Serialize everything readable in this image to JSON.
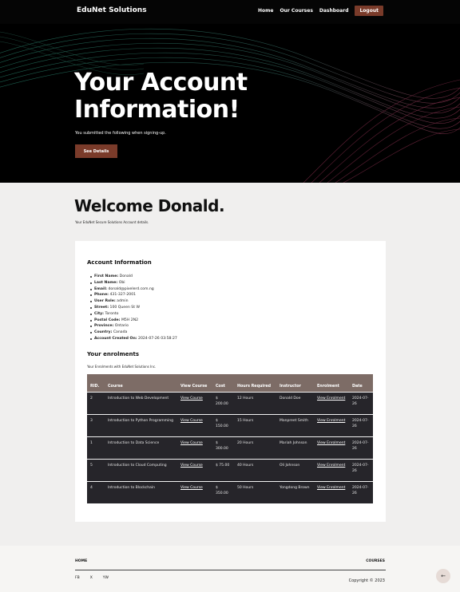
{
  "nav": {
    "brand": "EduNet Solutions",
    "links": [
      "Home",
      "Our Courses",
      "Dashboard"
    ],
    "logout": "Logout"
  },
  "hero": {
    "title_line1": "Your Account",
    "title_line2": "Information!",
    "subtitle": "You submitted the following when signing-up.",
    "button": "See Details"
  },
  "welcome": {
    "title": "Welcome Donald.",
    "subtitle": "Your EduNet Secure Solutions Account details."
  },
  "account": {
    "heading": "Account Information",
    "fields": [
      {
        "label": "First Name:",
        "value": "Donald"
      },
      {
        "label": "Last Name:",
        "value": "Obi"
      },
      {
        "label": "Email:",
        "value": "donald@pixelerd.com.ng"
      },
      {
        "label": "Phone:",
        "value": "431-327-2001"
      },
      {
        "label": "User Role:",
        "value": "admin"
      },
      {
        "label": "Street:",
        "value": "100 Queen St W"
      },
      {
        "label": "City:",
        "value": "Toronto"
      },
      {
        "label": "Postal Code:",
        "value": "M5H 2N2"
      },
      {
        "label": "Province:",
        "value": "Ontario"
      },
      {
        "label": "Country:",
        "value": "Canada"
      },
      {
        "label": "Account Created On:",
        "value": "2024-07-26 03:58:27"
      }
    ]
  },
  "enrolments": {
    "heading": "Your enrolments",
    "subtitle": "Your Enrolments with EduNet Solutions Inc.",
    "columns": [
      "RID.",
      "Course",
      "View Course",
      "Cost",
      "Hours Required",
      "Instructor",
      "Enrolment",
      "Date"
    ],
    "rows": [
      {
        "rid": "2",
        "course": "Introduction to Web Development",
        "view": "View Course",
        "cost": "$ 200.00",
        "hours": "12 Hours",
        "instructor": "Donald Doe",
        "enrolment": "View Enrolment",
        "date": "2024-07-26"
      },
      {
        "rid": "3",
        "course": "Introduction to Python Programming",
        "view": "View Course",
        "cost": "$ 150.00",
        "hours": "15 Hours",
        "instructor": "Manpreet Smith",
        "enrolment": "View Enrolment",
        "date": "2024-07-26"
      },
      {
        "rid": "1",
        "course": "Introduction to Data Science",
        "view": "View Course",
        "cost": "$ 300.00",
        "hours": "20 Hours",
        "instructor": "Mariah Johnson",
        "enrolment": "View Enrolment",
        "date": "2024-07-26"
      },
      {
        "rid": "5",
        "course": "Introduction to Cloud Computing",
        "view": "View Course",
        "cost": "$ 75.00",
        "hours": "40 Hours",
        "instructor": "Oli Johnson",
        "enrolment": "View Enrolment",
        "date": "2024-07-26"
      },
      {
        "rid": "4",
        "course": "Introduction to Blockchain",
        "view": "View Course",
        "cost": "$ 350.00",
        "hours": "50 Hours",
        "instructor": "Yongdong Brown",
        "enrolment": "View Enrolment",
        "date": "2024-07-26"
      }
    ]
  },
  "footer": {
    "home": "HOME",
    "courses": "COURSES",
    "social": [
      "FB",
      "X",
      "YW"
    ],
    "copyright": "Copyright © 2023"
  },
  "icons": {
    "up": "arrow-up-icon"
  },
  "colors": {
    "accent": "#7a3b2a",
    "table_header": "#7d6c66",
    "table_row": "#26252a"
  }
}
